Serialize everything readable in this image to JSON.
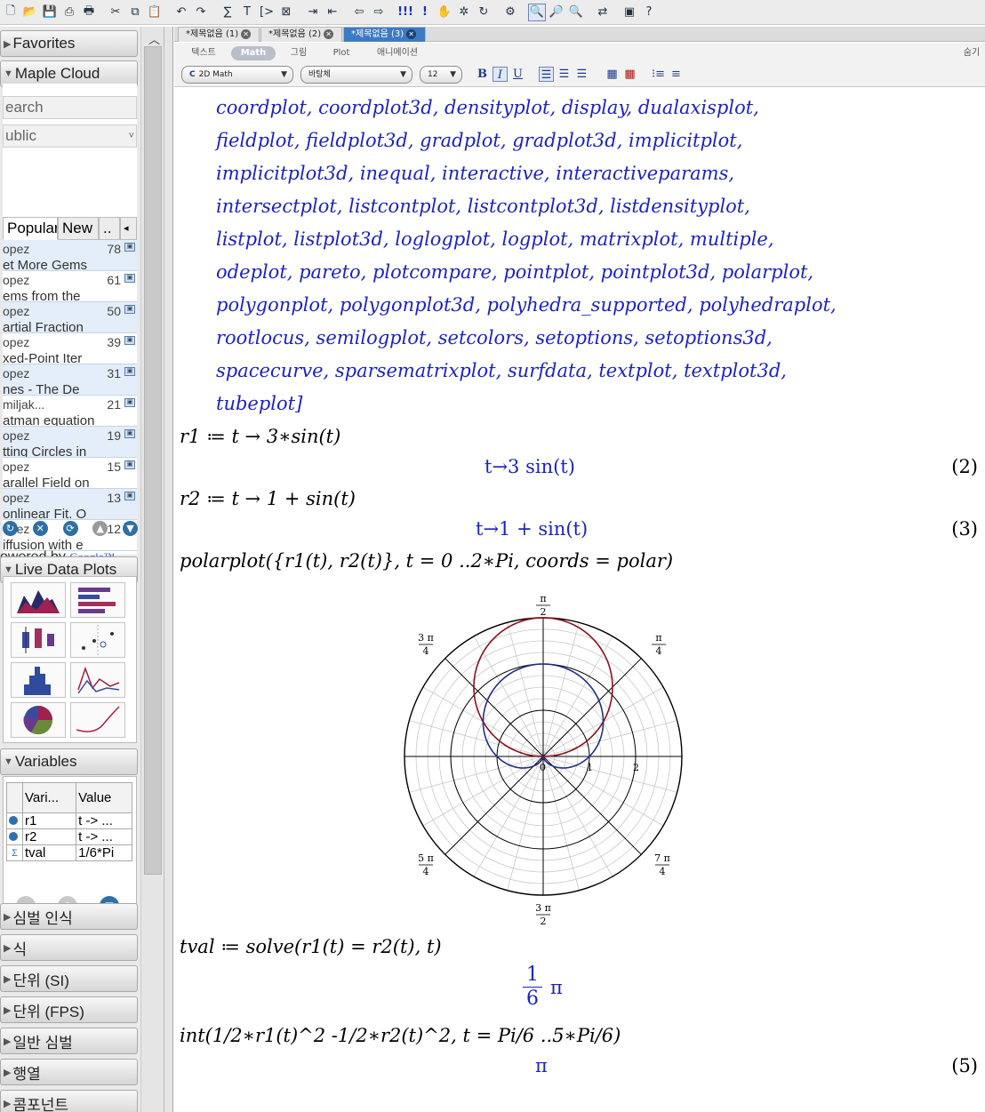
{
  "palette": {
    "favorites": "Favorites",
    "maple_cloud": "Maple Cloud",
    "search_placeholder": "earch",
    "group": "ublic",
    "tabs": [
      "Popular",
      "New",
      ".."
    ],
    "items": [
      {
        "author": "opez",
        "count": "78",
        "title": "et More Gems"
      },
      {
        "author": "opez",
        "count": "61",
        "title": "ems from the"
      },
      {
        "author": "opez",
        "count": "50",
        "title": "artial Fraction"
      },
      {
        "author": "opez",
        "count": "39",
        "title": "xed-Point Iter"
      },
      {
        "author": "opez",
        "count": "31",
        "title": "nes - The De"
      },
      {
        "author": "miljak...",
        "count": "21",
        "title": "atman equation"
      },
      {
        "author": "opez",
        "count": "19",
        "title": "tting Circles in"
      },
      {
        "author": "opez",
        "count": "15",
        "title": "arallel Field on"
      },
      {
        "author": "opez",
        "count": "13",
        "title": "onlinear Fit. O"
      },
      {
        "author": "opez",
        "count": "12",
        "title": "iffusion with e"
      }
    ],
    "powered_by": "owered by",
    "google": "Google™",
    "live_data_plots": "Live Data Plots",
    "variables": "Variables",
    "var_headers": [
      "Vari...",
      "Value"
    ],
    "var_rows": [
      {
        "name": "r1",
        "value": "t -> ..."
      },
      {
        "name": "r2",
        "value": "t -> ..."
      },
      {
        "name": "tval",
        "value": "1/6*Pi"
      }
    ],
    "sections": [
      "심벌 인식",
      "식",
      "단위 (SI)",
      "단위 (FPS)",
      "일반 심벌",
      "행열",
      "콤포넌트"
    ]
  },
  "document": {
    "tabs": [
      "*제목없음 (1)",
      "*제목없음 (2)",
      "*제목없음 (3)"
    ],
    "mode_tabs": [
      "텍스트",
      "Math",
      "그림",
      "Plot",
      "애니메이션"
    ],
    "hide_label": "숨기",
    "math_mode": "2D Math",
    "font_name": "바탕체",
    "font_size": "12",
    "output_lines": [
      "coordplot, coordplot3d, densityplot, display, dualaxisplot,",
      "fieldplot, fieldplot3d, gradplot, gradplot3d, implicitplot,",
      "implicitplot3d, inequal, interactive, interactiveparams,",
      "intersectplot, listcontplot, listcontplot3d, listdensityplot,",
      "listplot, listplot3d, loglogplot, logplot, matrixplot, multiple,",
      "odeplot, pareto, plotcompare, pointplot, pointplot3d, polarplot,",
      "polygonplot, polygonplot3d, polyhedra_supported, polyhedraplot,",
      "rootlocus, semilogplot, setcolors, setoptions, setoptions3d,",
      "spacecurve, sparsematrixplot, surfdata, textplot, textplot3d,",
      "tubeplot]"
    ],
    "in1": "r1 ≔ t → 3∗sin(t)",
    "out1": "t→3 sin(t)",
    "label1": "(2)",
    "in2": "r2 ≔ t → 1 + sin(t)",
    "out2": "t→1 + sin(t)",
    "label2": "(3)",
    "in3": "polarplot({r1(t), r2(t)}, t = 0 ..2∗Pi, coords = polar)",
    "in4": "tval ≔ solve(r1(t) = r2(t), t)",
    "out4_num": "1",
    "out4_den": "6",
    "out4_pi": "π",
    "in5": "int(1/2∗r1(t)^2 -1/2∗r2(t)^2, t = Pi/6 ..5∗Pi/6)",
    "out5": "π",
    "label5": "(5)"
  },
  "chart_data": {
    "type": "line",
    "coords": "polar",
    "series": [
      {
        "expr": "3*sin(t)",
        "color": "#8b1020",
        "t_range": [
          0,
          6.2832
        ]
      },
      {
        "expr": "1+sin(t)",
        "color": "#1f2f86",
        "t_range": [
          0,
          6.2832
        ]
      }
    ],
    "r_max": 3,
    "radial_ticks": [
      1,
      2
    ],
    "angle_labels": [
      {
        "num": "π",
        "den": "2"
      },
      {
        "num": "3 π",
        "den": "4"
      },
      {
        "num": "π",
        "den": "4"
      },
      {
        "num": "π",
        "den": ""
      },
      {
        "num": "0",
        "den": ""
      },
      {
        "num": "5 π",
        "den": "4"
      },
      {
        "num": "7 π",
        "den": "4"
      },
      {
        "num": "3 π",
        "den": "2"
      }
    ],
    "colors": {
      "grid_light": "#c8c8c8",
      "grid_dark": "#000000"
    }
  }
}
